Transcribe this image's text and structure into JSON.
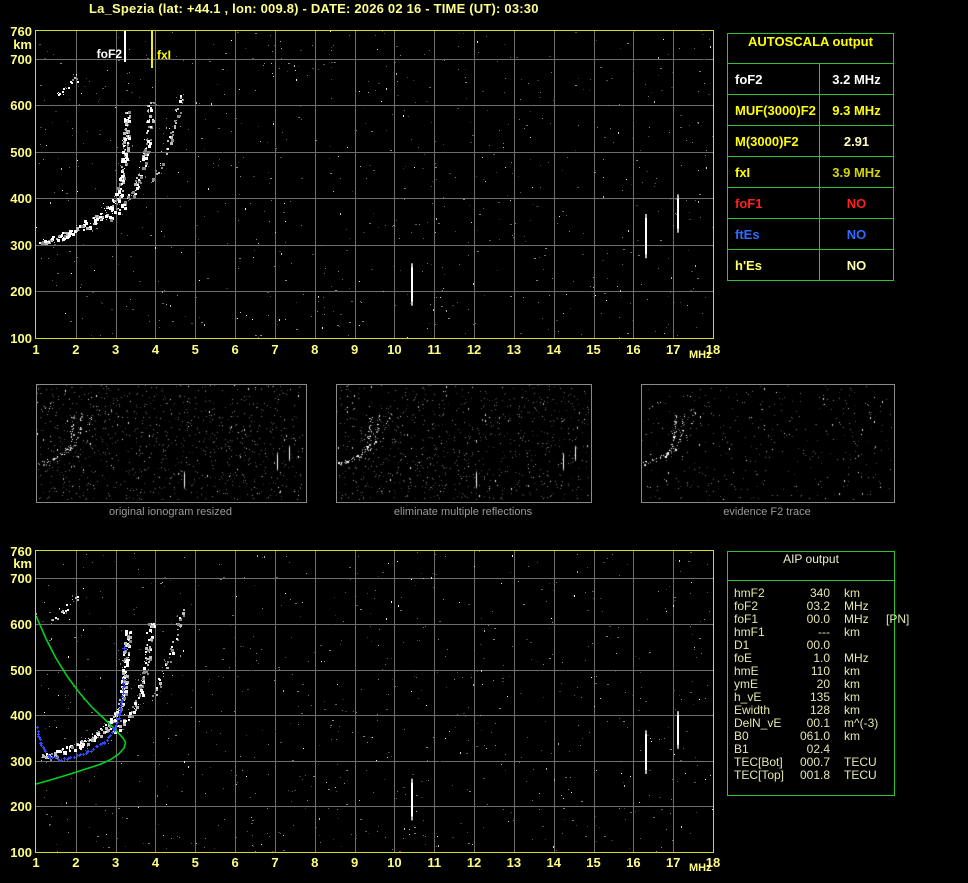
{
  "title": "La_Spezia (lat: +44.1 , lon: 009.8) - DATE: 2026 02 16 - TIME (UT): 03:30",
  "plot_labels": {
    "foF2_marker": "foF2",
    "fxI_marker": "fxI",
    "y_unit": "km",
    "x_unit": "MHz"
  },
  "autoscala_table": {
    "header": "AUTOSCALA output",
    "rows": [
      {
        "label": "foF2",
        "value": "3.2 MHz",
        "label_color": "#ffffff",
        "value_color": "#ffffff"
      },
      {
        "label": "MUF(3000)F2",
        "value": "9.3 MHz",
        "label_color": "#ffff00",
        "value_color": "#ffff00"
      },
      {
        "label": "M(3000)F2",
        "value": "2.91",
        "label_color": "#ffff00",
        "value_color": "#ffffbb"
      },
      {
        "label": "fxI",
        "value": "3.9 MHz",
        "label_color": "#ffff00",
        "value_color": "#d4d400"
      },
      {
        "label": "foF1",
        "value": "NO",
        "label_color": "#ff2020",
        "value_color": "#ff2020"
      },
      {
        "label": "ftEs",
        "value": "NO",
        "label_color": "#2f6bff",
        "value_color": "#2f6bff"
      },
      {
        "label": "h'Es",
        "value": "NO",
        "label_color": "#ffff70",
        "value_color": "#ffffb0"
      }
    ]
  },
  "aip_table": {
    "header": "AIP output",
    "rows": [
      {
        "name": "hmF2",
        "value": "340",
        "unit": "km",
        "extra": ""
      },
      {
        "name": "foF2",
        "value": "03.2",
        "unit": "MHz",
        "extra": ""
      },
      {
        "name": "foF1",
        "value": "00.0",
        "unit": "MHz",
        "extra": "[PN]"
      },
      {
        "name": "hmF1",
        "value": "---",
        "unit": "km",
        "extra": ""
      },
      {
        "name": "D1",
        "value": "00.0",
        "unit": "",
        "extra": ""
      },
      {
        "name": "foE",
        "value": "1.0",
        "unit": "MHz",
        "extra": ""
      },
      {
        "name": "hmE",
        "value": "110",
        "unit": "km",
        "extra": ""
      },
      {
        "name": "ymE",
        "value": "20",
        "unit": "km",
        "extra": ""
      },
      {
        "name": "h_vE",
        "value": "135",
        "unit": "km",
        "extra": ""
      },
      {
        "name": "Ewidth",
        "value": "128",
        "unit": "km",
        "extra": ""
      },
      {
        "name": "DelN_vE",
        "value": "00.1",
        "unit": "m^(-3)",
        "extra": ""
      },
      {
        "name": "B0",
        "value": "061.0",
        "unit": "km",
        "extra": ""
      },
      {
        "name": "B1",
        "value": "02.4",
        "unit": "",
        "extra": ""
      },
      {
        "name": "TEC[Bot]",
        "value": "000.7",
        "unit": "TECU",
        "extra": ""
      },
      {
        "name": "TEC[Top]",
        "value": "001.8",
        "unit": "TECU",
        "extra": ""
      }
    ]
  },
  "thumbnails": [
    {
      "caption": "original ionogram resized"
    },
    {
      "caption": "eliminate multiple reflections"
    },
    {
      "caption": "evidence F2 trace"
    }
  ],
  "chart_data": [
    {
      "name": "main-ionogram",
      "type": "scatter",
      "xlabel": "MHz",
      "ylabel": "km",
      "xlim": [
        1,
        18
      ],
      "ylim": [
        100,
        760
      ],
      "grid": true,
      "x_ticks": [
        1,
        2,
        3,
        4,
        5,
        6,
        7,
        8,
        9,
        10,
        11,
        12,
        13,
        14,
        15,
        16,
        17,
        18
      ],
      "y_ticks": [
        760,
        700,
        600,
        500,
        400,
        300,
        200,
        100
      ],
      "markers": {
        "foF2_MHz": 3.2,
        "fxI_MHz": 3.9
      },
      "traces": {
        "f2_ordinary": [
          [
            1.1,
            305
          ],
          [
            1.35,
            311
          ],
          [
            1.6,
            318
          ],
          [
            1.85,
            326
          ],
          [
            2.1,
            336
          ],
          [
            2.35,
            347
          ],
          [
            2.6,
            360
          ],
          [
            2.8,
            374
          ],
          [
            2.95,
            389
          ],
          [
            3.05,
            406
          ],
          [
            3.13,
            428
          ],
          [
            3.19,
            458
          ],
          [
            3.23,
            498
          ],
          [
            3.27,
            542
          ],
          [
            3.3,
            582
          ]
        ],
        "f2_extraordinary": [
          [
            2.9,
            362
          ],
          [
            3.1,
            378
          ],
          [
            3.3,
            396
          ],
          [
            3.45,
            415
          ],
          [
            3.57,
            437
          ],
          [
            3.66,
            463
          ],
          [
            3.73,
            494
          ],
          [
            3.79,
            530
          ],
          [
            3.84,
            566
          ],
          [
            3.88,
            601
          ]
        ],
        "spread_echo": [
          [
            3.95,
            432
          ],
          [
            4.1,
            468
          ],
          [
            4.25,
            504
          ],
          [
            4.4,
            542
          ],
          [
            4.55,
            586
          ],
          [
            4.68,
            632
          ]
        ],
        "multiple_reflection": [
          [
            1.45,
            612
          ],
          [
            1.65,
            629
          ],
          [
            1.85,
            646
          ],
          [
            2.05,
            663
          ]
        ]
      },
      "interference_streaks": [
        {
          "f": 10.45,
          "h": [
            178,
            252
          ]
        },
        {
          "f": 16.32,
          "h": [
            280,
            358
          ]
        },
        {
          "f": 17.12,
          "h": [
            335,
            400
          ]
        }
      ]
    },
    {
      "name": "aip-ionogram",
      "type": "scatter",
      "xlabel": "MHz",
      "ylabel": "km",
      "xlim": [
        1,
        18
      ],
      "ylim": [
        100,
        760
      ],
      "grid": true,
      "x_ticks": [
        1,
        2,
        3,
        4,
        5,
        6,
        7,
        8,
        9,
        10,
        11,
        12,
        13,
        14,
        15,
        16,
        17,
        18
      ],
      "y_ticks": [
        760,
        700,
        600,
        500,
        400,
        300,
        200,
        100
      ],
      "profile_curve": [
        [
          1.0,
          618
        ],
        [
          1.25,
          568
        ],
        [
          1.5,
          525
        ],
        [
          1.8,
          483
        ],
        [
          2.1,
          448
        ],
        [
          2.4,
          418
        ],
        [
          2.7,
          393
        ],
        [
          2.95,
          372
        ],
        [
          3.1,
          358
        ],
        [
          3.2,
          348
        ],
        [
          3.25,
          340
        ],
        [
          3.21,
          328
        ],
        [
          3.08,
          315
        ],
        [
          2.88,
          303
        ],
        [
          2.6,
          292
        ],
        [
          2.25,
          282
        ],
        [
          1.9,
          272
        ],
        [
          1.55,
          263
        ],
        [
          1.25,
          255
        ],
        [
          1.0,
          249
        ]
      ],
      "scaled_trace": [
        [
          1.02,
          372
        ],
        [
          1.07,
          352
        ],
        [
          1.13,
          336
        ],
        [
          1.22,
          321
        ],
        [
          1.35,
          310
        ],
        [
          1.55,
          304
        ],
        [
          1.8,
          305
        ],
        [
          2.05,
          311
        ],
        [
          2.3,
          320
        ],
        [
          2.52,
          330
        ],
        [
          2.7,
          342
        ],
        [
          2.85,
          356
        ],
        [
          2.97,
          372
        ],
        [
          3.06,
          392
        ],
        [
          3.12,
          415
        ],
        [
          3.16,
          440
        ],
        [
          3.19,
          462
        ],
        [
          3.21,
          478
        ]
      ],
      "isolated_points": [
        [
          3.22,
          547
        ]
      ],
      "interference_streaks": [
        {
          "f": 10.45,
          "h": [
            178,
            252
          ]
        },
        {
          "f": 16.32,
          "h": [
            280,
            358
          ]
        },
        {
          "f": 17.12,
          "h": [
            335,
            400
          ]
        }
      ]
    }
  ]
}
